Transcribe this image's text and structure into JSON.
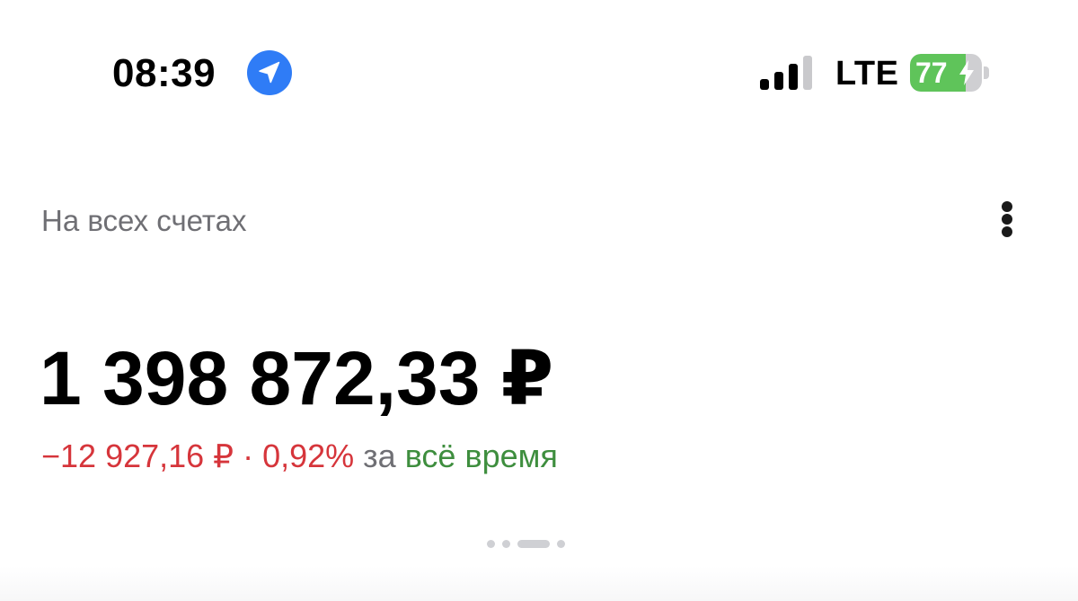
{
  "status_bar": {
    "time": "08:39",
    "network": "LTE",
    "battery_level": "77",
    "battery_fraction": 0.77,
    "signal_bars_active": 3,
    "signal_bars_total": 4,
    "location_icon": "location-arrow-icon",
    "colors": {
      "location": "#2f7cf6",
      "battery_fill": "#5fc45a"
    }
  },
  "header": {
    "title": "На всех счетах",
    "menu_icon": "more-vertical-icon"
  },
  "balance": {
    "amount": "1 398 872,33 ₽"
  },
  "change": {
    "amount": "−12 927,16 ₽",
    "separator": " · ",
    "percent": "0,92%",
    "preposition": " за ",
    "period": "всё время",
    "colors": {
      "negative": "#d6353b",
      "period": "#3e8e3e",
      "muted": "#6f6f74"
    }
  },
  "pager": {
    "pages": 4,
    "active_index": 2
  }
}
